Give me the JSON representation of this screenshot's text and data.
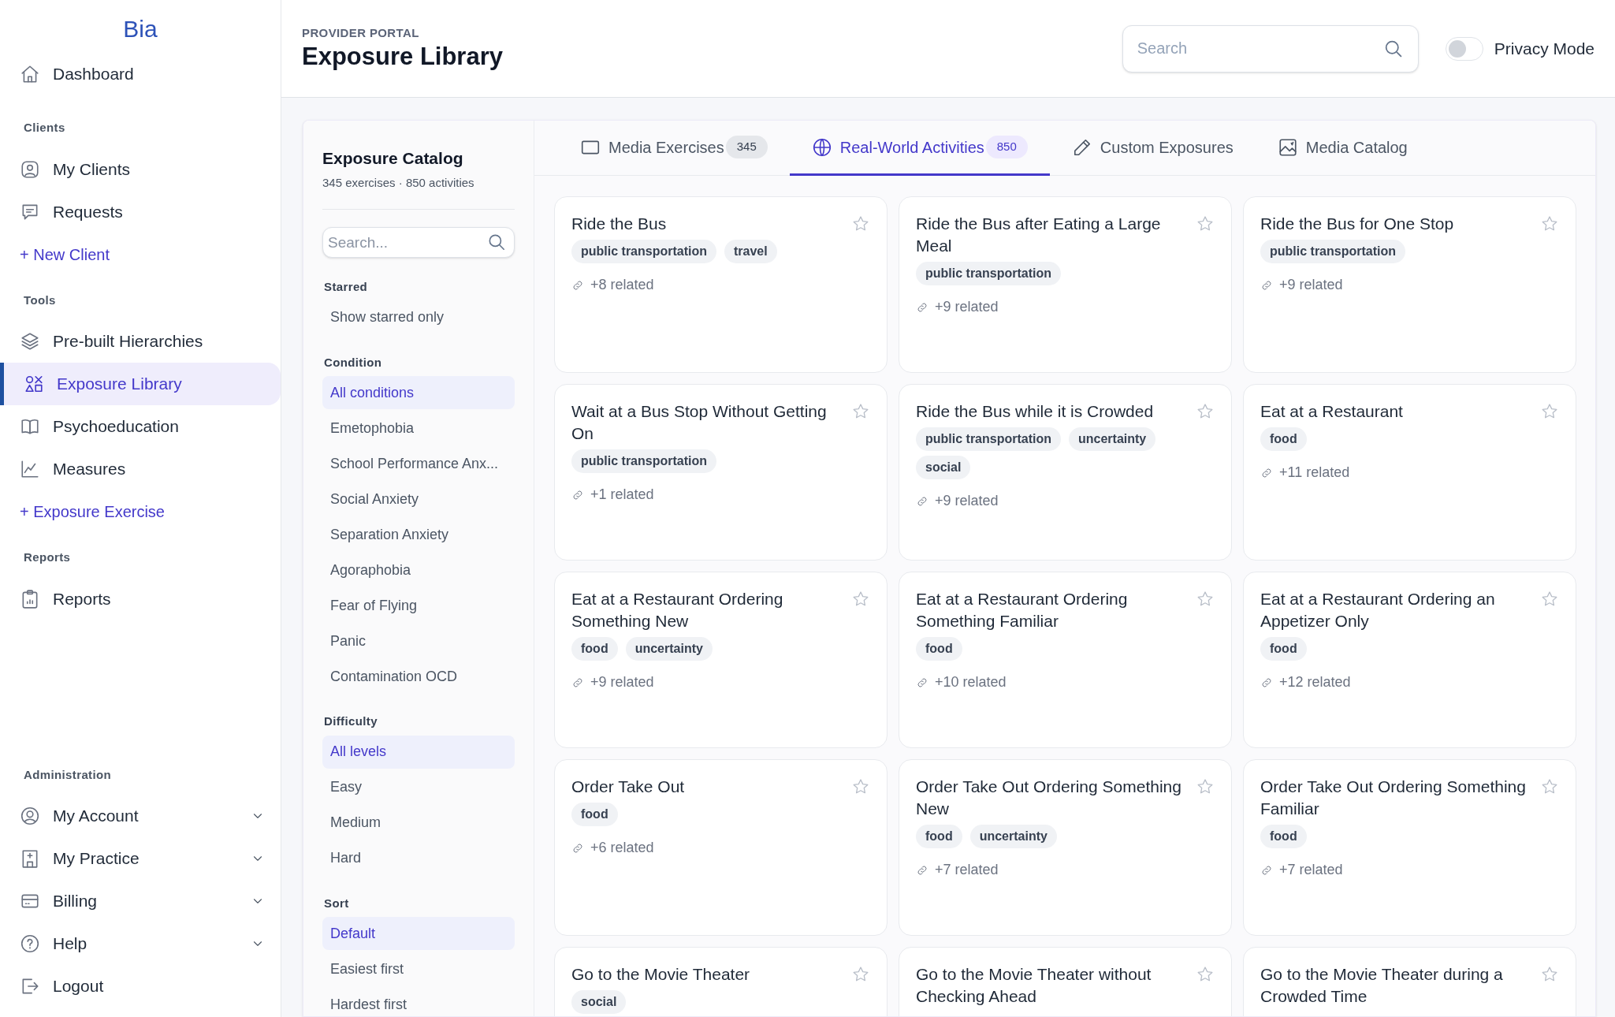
{
  "sidebar": {
    "logo": "Bia",
    "sections": [
      {
        "items": [
          {
            "label": "Dashboard",
            "kind": "link",
            "selected": false
          }
        ]
      },
      {
        "heading": "Clients",
        "items": [
          {
            "label": "My Clients",
            "kind": "link",
            "selected": false
          },
          {
            "label": "Requests",
            "kind": "link",
            "selected": false
          },
          {
            "label": "+ New Client",
            "kind": "add"
          }
        ]
      },
      {
        "heading": "Tools",
        "items": [
          {
            "label": "Pre-built Hierarchies",
            "kind": "link",
            "selected": false
          },
          {
            "label": "Exposure Library",
            "kind": "link",
            "selected": true
          },
          {
            "label": "Psychoeducation",
            "kind": "link",
            "selected": false
          },
          {
            "label": "Measures",
            "kind": "link",
            "selected": false
          },
          {
            "label": "+ Exposure Exercise",
            "kind": "add"
          }
        ]
      },
      {
        "heading": "Reports",
        "items": [
          {
            "label": "Reports",
            "kind": "link",
            "selected": false
          }
        ]
      },
      {
        "heading": "Administration",
        "items": [
          {
            "label": "My Account",
            "kind": "menu",
            "selected": false
          },
          {
            "label": "My Practice",
            "kind": "menu",
            "selected": false
          },
          {
            "label": "Billing",
            "kind": "menu",
            "selected": false
          },
          {
            "label": "Help",
            "kind": "menu",
            "selected": false
          },
          {
            "label": "Logout",
            "kind": "link",
            "selected": false
          }
        ]
      }
    ]
  },
  "header": {
    "eyebrow": "PROVIDER PORTAL",
    "title": "Exposure Library",
    "search": {
      "placeholder": "Search"
    },
    "privacy_mode": {
      "label": "Privacy Mode",
      "on": false
    }
  },
  "catalog": {
    "title": "Exposure Catalog",
    "subtitle": "345 exercises · 850 activities",
    "search": {
      "placeholder": "Search..."
    },
    "groups": [
      {
        "heading": "Starred",
        "options": [
          {
            "label": "Show starred only",
            "selected": false
          }
        ]
      },
      {
        "heading": "Condition",
        "options": [
          {
            "label": "All conditions",
            "selected": true
          },
          {
            "label": "Emetophobia",
            "selected": false
          },
          {
            "label": "School Performance Anx...",
            "selected": false
          },
          {
            "label": "Social Anxiety",
            "selected": false
          },
          {
            "label": "Separation Anxiety",
            "selected": false
          },
          {
            "label": "Agoraphobia",
            "selected": false
          },
          {
            "label": "Fear of Flying",
            "selected": false
          },
          {
            "label": "Panic",
            "selected": false
          },
          {
            "label": "Contamination OCD",
            "selected": false
          }
        ]
      },
      {
        "heading": "Difficulty",
        "options": [
          {
            "label": "All levels",
            "selected": true
          },
          {
            "label": "Easy",
            "selected": false
          },
          {
            "label": "Medium",
            "selected": false
          },
          {
            "label": "Hard",
            "selected": false
          }
        ]
      },
      {
        "heading": "Sort",
        "options": [
          {
            "label": "Default",
            "selected": true
          },
          {
            "label": "Easiest first",
            "selected": false
          },
          {
            "label": "Hardest first",
            "selected": false
          }
        ]
      }
    ]
  },
  "tabs": [
    {
      "label": "Media Exercises",
      "count": "345",
      "selected": false
    },
    {
      "label": "Real-World Activities",
      "count": "850",
      "selected": true
    },
    {
      "label": "Custom Exposures",
      "selected": false
    },
    {
      "label": "Media Catalog",
      "selected": false
    }
  ],
  "cards": [
    {
      "title": "Ride the Bus",
      "tags": [
        "public transportation",
        "travel"
      ],
      "related": "+8 related",
      "starred": false
    },
    {
      "title": "Ride the Bus after Eating a Large Meal",
      "tags": [
        "public transportation"
      ],
      "related": "+9 related",
      "starred": false
    },
    {
      "title": "Ride the Bus for One Stop",
      "tags": [
        "public transportation"
      ],
      "related": "+9 related",
      "starred": false
    },
    {
      "title": "Wait at a Bus Stop Without Getting On",
      "tags": [
        "public transportation"
      ],
      "related": "+1 related",
      "starred": false
    },
    {
      "title": "Ride the Bus while it is Crowded",
      "tags": [
        "public transportation",
        "uncertainty",
        "social"
      ],
      "related": "+9 related",
      "starred": false
    },
    {
      "title": "Eat at a Restaurant",
      "tags": [
        "food"
      ],
      "related": "+11 related",
      "starred": false
    },
    {
      "title": "Eat at a Restaurant Ordering Something New",
      "tags": [
        "food",
        "uncertainty"
      ],
      "related": "+9 related",
      "starred": false
    },
    {
      "title": "Eat at a Restaurant Ordering Something Familiar",
      "tags": [
        "food"
      ],
      "related": "+10 related",
      "starred": false
    },
    {
      "title": "Eat at a Restaurant Ordering an Appetizer Only",
      "tags": [
        "food"
      ],
      "related": "+12 related",
      "starred": false
    },
    {
      "title": "Order Take Out",
      "tags": [
        "food"
      ],
      "related": "+6 related",
      "starred": false
    },
    {
      "title": "Order Take Out Ordering Something New",
      "tags": [
        "food",
        "uncertainty"
      ],
      "related": "+7 related",
      "starred": false
    },
    {
      "title": "Order Take Out Ordering Something Familiar",
      "tags": [
        "food"
      ],
      "related": "+7 related",
      "starred": false
    },
    {
      "title": "Go to the Movie Theater",
      "tags": [
        "social"
      ],
      "starred": false
    },
    {
      "title": "Go to the Movie Theater without Checking Ahead",
      "starred": false
    },
    {
      "title": "Go to the Movie Theater during a Crowded Time",
      "starred": false
    }
  ]
}
